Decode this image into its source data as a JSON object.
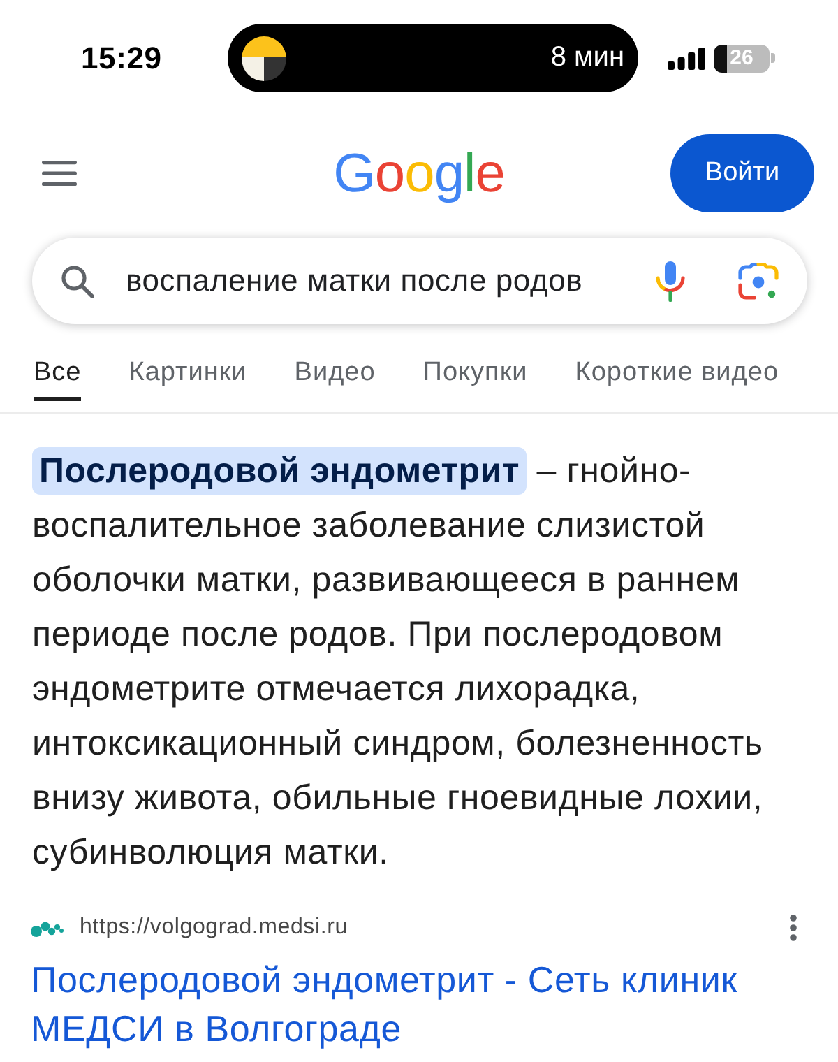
{
  "status_bar": {
    "time": "15:29",
    "island_text": "8 мин",
    "battery": "26"
  },
  "header": {
    "logo": "Google",
    "sign_in": "Войти"
  },
  "search": {
    "value": "воспаление матки после родов"
  },
  "tabs": [
    {
      "label": "Все",
      "selected": true
    },
    {
      "label": "Картинки",
      "selected": false
    },
    {
      "label": "Видео",
      "selected": false
    },
    {
      "label": "Покупки",
      "selected": false
    },
    {
      "label": "Короткие видео",
      "selected": false
    }
  ],
  "snippet": {
    "text": "**Послеродовой эндометрит** – гнойно-воспалительное заболевание слизистой оболочки матки, развивающееся в раннем периоде после родов. При послеродовом эндометрите отмечается лихорадка, интоксикационный синдром, болезненность внизу живота, обильные гноевидные лохии, субинволюция матки."
  },
  "result": {
    "url": "https://volgograd.medsi.ru",
    "title": "Послеродовой эндометрит - Сеть клиник МЕДСИ в Волгограде"
  }
}
